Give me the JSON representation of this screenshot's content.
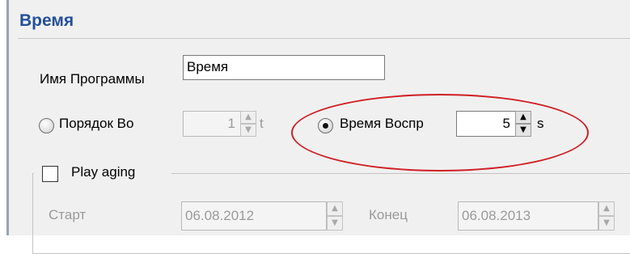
{
  "section_title": "Время",
  "program_name": {
    "label": "Имя Программы",
    "value": "Время"
  },
  "order_option": {
    "label": "Порядок Во",
    "value": "1",
    "unit": "t",
    "selected": false
  },
  "time_option": {
    "label": "Время Воспр",
    "value": "5",
    "unit": "s",
    "selected": true
  },
  "play_aging": {
    "label": "Play aging",
    "checked": false,
    "start_label": "Старт",
    "start_value": "06.08.2012",
    "end_label": "Конец",
    "end_value": "06.08.2013"
  },
  "colors": {
    "title": "#24509a",
    "highlight_oval": "#d01e24"
  }
}
